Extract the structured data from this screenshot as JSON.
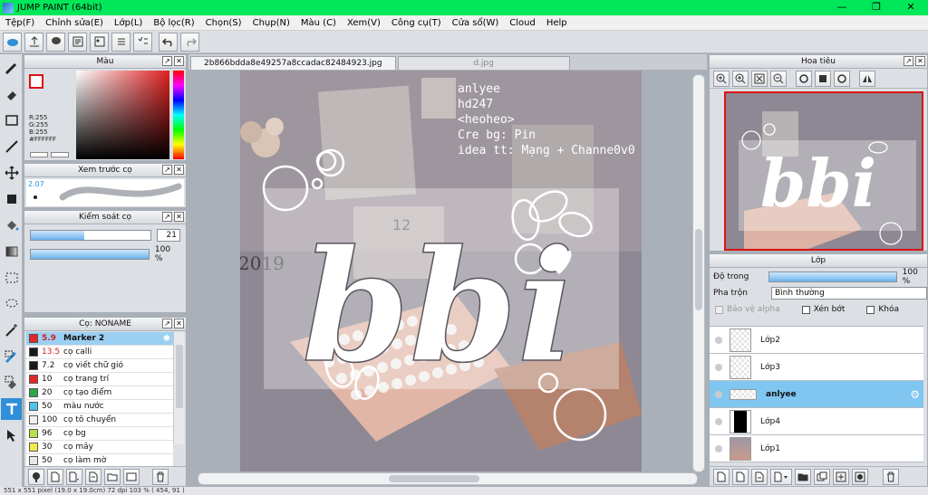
{
  "window": {
    "title": "JUMP PAINT (64bit)",
    "min": "—",
    "max": "❐",
    "close": "✕"
  },
  "menu": [
    "Tệp(F)",
    "Chỉnh sửa(E)",
    "Lớp(L)",
    "Bộ lọc(R)",
    "Chọn(S)",
    "Chụp(N)",
    "Màu (C)",
    "Xem(V)",
    "Công cụ(T)",
    "Cửa sổ(W)",
    "Cloud",
    "Help"
  ],
  "panels": {
    "color": {
      "title": "Màu",
      "rgb": [
        "R:255",
        "G:255",
        "B:255",
        "#FFFFFF"
      ]
    },
    "preview": {
      "title": "Xem trước cọ",
      "size": "2.07"
    },
    "control": {
      "title": "Kiểm soát cọ",
      "size_value": "21",
      "opacity_value": "100 %",
      "size_fill": 0.45,
      "opacity_fill": 1.0
    },
    "brushes": {
      "title": "Cọ: NONAME",
      "items": [
        {
          "size": "5.9",
          "name": "Marker 2",
          "color": "#e02828",
          "selected": true
        },
        {
          "size": "13.5",
          "name": "cọ calli",
          "color": "#1a1a1a"
        },
        {
          "size": "7.2",
          "name": "cọ viết chữ gió",
          "color": "#1a1a1a"
        },
        {
          "size": "10",
          "name": "cọ trang trí",
          "color": "#e02828"
        },
        {
          "size": "20",
          "name": "cọ tạo điểm",
          "color": "#2aa84a"
        },
        {
          "size": "50",
          "name": "màu nước",
          "color": "#4cc4e8"
        },
        {
          "size": "100",
          "name": "cọ tô chuyển",
          "color": "#f0f0f0"
        },
        {
          "size": "96",
          "name": "cọ bg",
          "color": "#b6e04a"
        },
        {
          "size": "30",
          "name": "cọ mây",
          "color": "#f2ec4a"
        },
        {
          "size": "50",
          "name": "cọ làm mờ",
          "color": "#e8e8e8"
        }
      ]
    },
    "navigator": {
      "title": "Hoa tiêu"
    },
    "layers": {
      "title": "Lớp",
      "opacity_label": "Độ trong",
      "opacity_value": "100 %",
      "blend_label": "Pha trộn",
      "blend_value": "Bình thường",
      "check_alpha": "Bảo vệ alpha",
      "check_clip": "Xén bớt",
      "check_lock": "Khóa",
      "items": [
        {
          "name": "Lớp2",
          "thumb": "transparent"
        },
        {
          "name": "Lớp3",
          "thumb": "transparent"
        },
        {
          "name": "anlyee",
          "thumb": "transparent",
          "selected": true
        },
        {
          "name": "Lớp4",
          "thumb": "black"
        },
        {
          "name": "Lớp1",
          "thumb": "photo"
        }
      ]
    }
  },
  "tabs": [
    {
      "label": "2b866bdda8e49257a8ccadac82484923.jpg",
      "active": true
    },
    {
      "label": "d.jpg",
      "active": false
    }
  ],
  "artwork": {
    "credits": [
      "anlyee",
      "hd247",
      "<heoheo>",
      "Cre bg: Pin",
      "idea tt: Mạng + Channe0v0"
    ],
    "main_text": "bbi",
    "calendar_number": "12",
    "year_text": "2019"
  },
  "statusbar": "551 x 551 pixel  (19.0 x 19.0cm)  72 dpi  103 %  ( 454, 91 )",
  "colors": {
    "accent": "#2f8fd8",
    "titlebar": "#00e85a",
    "selection": "#7fc6f1"
  }
}
